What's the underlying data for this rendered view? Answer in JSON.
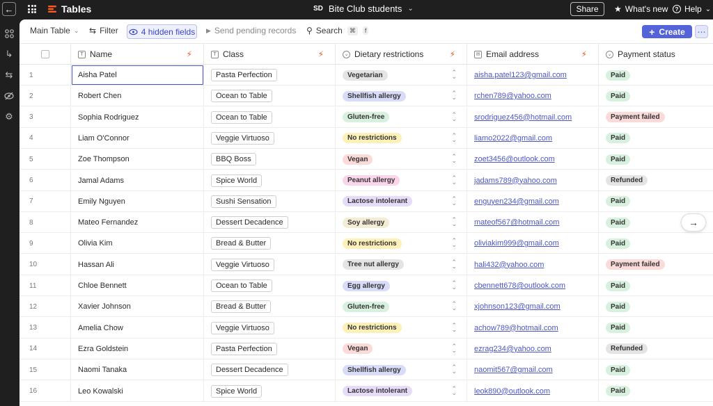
{
  "app": {
    "name": "Tables"
  },
  "workspace": {
    "badge": "SD",
    "name": "Bite Club students"
  },
  "topbar": {
    "share_label": "Share",
    "whats_new_label": "What's new",
    "help_label": "Help"
  },
  "toolbar": {
    "view_label": "Main Table",
    "filter_label": "Filter",
    "hidden_fields_label": "4 hidden fields",
    "send_pending_label": "Send pending records",
    "search_label": "Search",
    "search_shortcut_mod": "⌘",
    "search_shortcut_key": "f",
    "create_label": "Create"
  },
  "columns": [
    {
      "label": "Name",
      "type_icon": "text-field-icon"
    },
    {
      "label": "Class",
      "type_icon": "text-field-icon"
    },
    {
      "label": "Dietary restrictions",
      "type_icon": "dropdown-field-icon"
    },
    {
      "label": "Email address",
      "type_icon": "email-field-icon"
    },
    {
      "label": "Payment status",
      "type_icon": "dropdown-field-icon"
    }
  ],
  "pill_colors": {
    "Vegetarian": "#e4e4e4",
    "Shellfish allergy": "#d9dcf9",
    "Gluten-free": "#d8f1df",
    "No restrictions": "#fdf0b8",
    "Vegan": "#fbdada",
    "Peanut allergy": "#fbd6ea",
    "Lactose intolerant": "#e6dbf8",
    "Soy allergy": "#f5ecd6",
    "Tree nut allergy": "#e4e4e4",
    "Egg allergy": "#d9dcf9",
    "Paid": "#d8f1df",
    "Payment failed": "#fbdada",
    "Refunded": "#e4e4e4"
  },
  "rows": [
    {
      "num": "1",
      "name": "Aisha Patel",
      "class": "Pasta Perfection",
      "diet": "Vegetarian",
      "email": "aisha.patel123@gmail.com",
      "payment": "Paid"
    },
    {
      "num": "2",
      "name": "Robert Chen",
      "class": "Ocean to Table",
      "diet": "Shellfish allergy",
      "email": "rchen789@yahoo.com",
      "payment": "Paid"
    },
    {
      "num": "3",
      "name": "Sophia Rodriguez",
      "class": "Ocean to Table",
      "diet": "Gluten-free",
      "email": "srodriguez456@hotmail.com",
      "payment": "Payment failed"
    },
    {
      "num": "4",
      "name": "Liam O'Connor",
      "class": "Veggie Virtuoso",
      "diet": "No restrictions",
      "email": "liamo2022@gmail.com",
      "payment": "Paid"
    },
    {
      "num": "5",
      "name": "Zoe Thompson",
      "class": "BBQ Boss",
      "diet": "Vegan",
      "email": "zoet3456@outlook.com",
      "payment": "Paid"
    },
    {
      "num": "6",
      "name": "Jamal Adams",
      "class": "Spice World",
      "diet": "Peanut allergy",
      "email": "jadams789@yahoo.com",
      "payment": "Refunded"
    },
    {
      "num": "7",
      "name": "Emily Nguyen",
      "class": "Sushi Sensation",
      "diet": "Lactose intolerant",
      "email": "enguyen234@gmail.com",
      "payment": "Paid"
    },
    {
      "num": "8",
      "name": "Mateo Fernandez",
      "class": "Dessert Decadence",
      "diet": "Soy allergy",
      "email": "mateof567@hotmail.com",
      "payment": "Paid"
    },
    {
      "num": "9",
      "name": "Olivia Kim",
      "class": "Bread & Butter",
      "diet": "No restrictions",
      "email": "oliviakim999@gmail.com",
      "payment": "Paid"
    },
    {
      "num": "10",
      "name": "Hassan Ali",
      "class": "Veggie Virtuoso",
      "diet": "Tree nut allergy",
      "email": "hali432@yahoo.com",
      "payment": "Payment failed"
    },
    {
      "num": "11",
      "name": "Chloe Bennett",
      "class": "Ocean to Table",
      "diet": "Egg allergy",
      "email": "cbennett678@outlook.com",
      "payment": "Paid"
    },
    {
      "num": "12",
      "name": "Xavier Johnson",
      "class": "Bread & Butter",
      "diet": "Gluten-free",
      "email": "xjohnson123@gmail.com",
      "payment": "Paid"
    },
    {
      "num": "13",
      "name": "Amelia Chow",
      "class": "Veggie Virtuoso",
      "diet": "No restrictions",
      "email": "achow789@hotmail.com",
      "payment": "Paid"
    },
    {
      "num": "14",
      "name": "Ezra Goldstein",
      "class": "Pasta Perfection",
      "diet": "Vegan",
      "email": "ezrag234@yahoo.com",
      "payment": "Refunded"
    },
    {
      "num": "15",
      "name": "Naomi Tanaka",
      "class": "Dessert Decadence",
      "diet": "Shellfish allergy",
      "email": "naomit567@gmail.com",
      "payment": "Paid"
    },
    {
      "num": "16",
      "name": "Leo Kowalski",
      "class": "Spice World",
      "diet": "Lactose intolerant",
      "email": "leok890@outlook.com",
      "payment": "Paid"
    }
  ],
  "selected_row": 0
}
